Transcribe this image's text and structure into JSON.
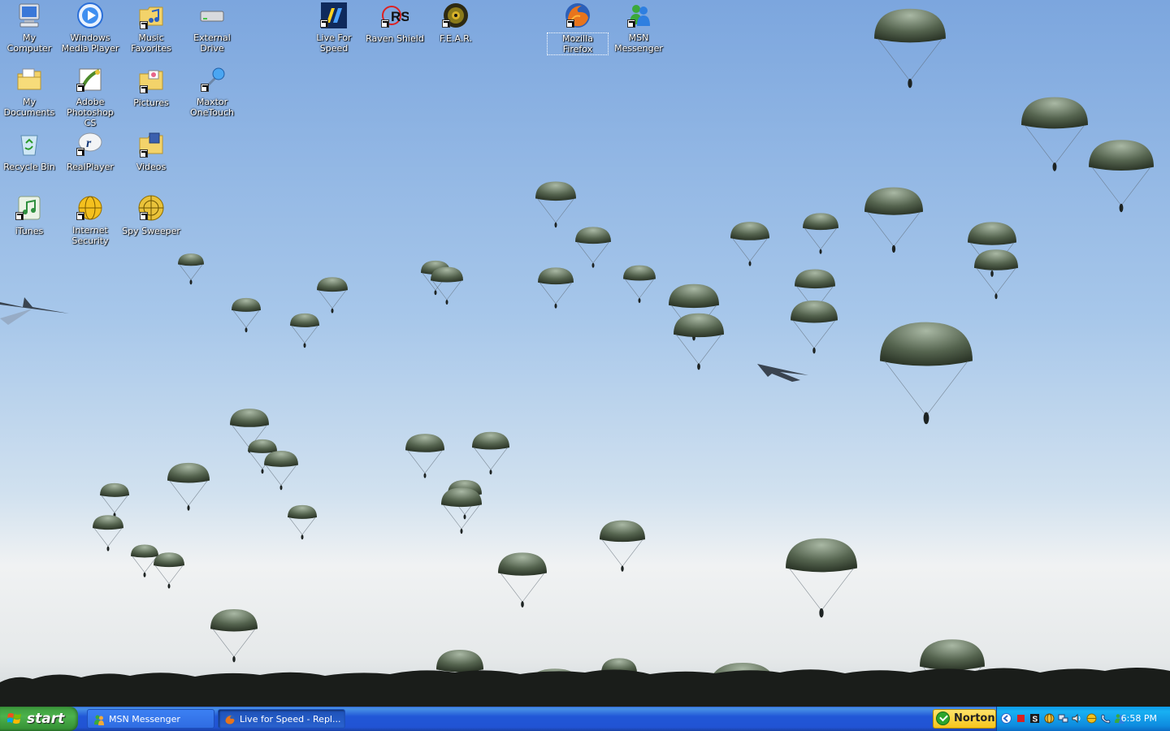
{
  "desktop": {
    "icons": [
      {
        "label": "My Computer"
      },
      {
        "label": "Windows Media Player"
      },
      {
        "label": "Music Favorites"
      },
      {
        "label": "External Drive"
      },
      {
        "label": "Live For Speed"
      },
      {
        "label": "Raven Shield"
      },
      {
        "label": "F.E.A.R."
      },
      {
        "label": "Mozilla Firefox"
      },
      {
        "label": "MSN Messenger"
      },
      {
        "label": "My Documents"
      },
      {
        "label": "Adobe Photoshop CS"
      },
      {
        "label": "Pictures"
      },
      {
        "label": "Maxtor OneTouch"
      },
      {
        "label": "Recycle Bin"
      },
      {
        "label": "RealPlayer"
      },
      {
        "label": "Videos"
      },
      {
        "label": "iTunes"
      },
      {
        "label": "Internet Security"
      },
      {
        "label": "Spy Sweeper"
      }
    ],
    "raven_shield_badge": "RS"
  },
  "taskbar": {
    "start_label": "start",
    "tasks": [
      {
        "label": "MSN Messenger"
      },
      {
        "label": "Live for Speed - Repl..."
      }
    ],
    "norton_label": "Norton",
    "clock": "6:58 PM"
  },
  "colors": {
    "taskbar_blue": "#2157d7",
    "start_green": "#4cb24c",
    "tray_blue": "#18b0f3",
    "sky_top": "#7ca6de",
    "sky_bottom": "#e9eef2"
  }
}
